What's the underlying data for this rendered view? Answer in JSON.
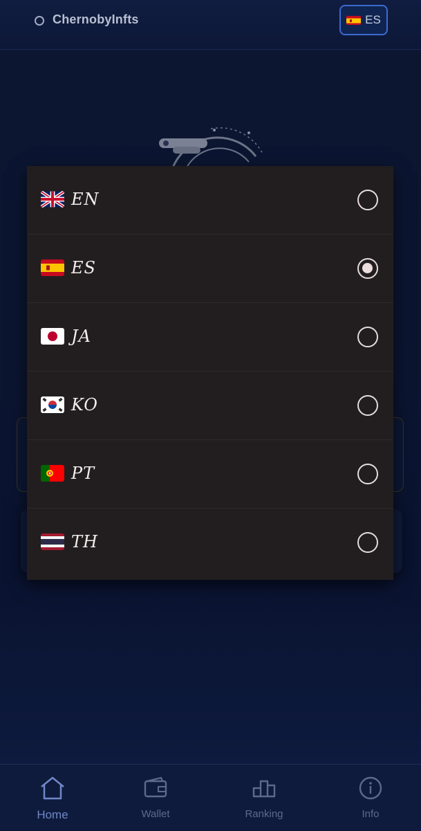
{
  "header": {
    "title": "ChernobyInfts",
    "language_button": {
      "flag": "spain-flag",
      "label": "ES"
    }
  },
  "language_modal": {
    "options": [
      {
        "code": "EN",
        "flag": "uk-flag",
        "selected": false
      },
      {
        "code": "ES",
        "flag": "spain-flag",
        "selected": true
      },
      {
        "code": "JA",
        "flag": "japan-flag",
        "selected": false
      },
      {
        "code": "KO",
        "flag": "korea-flag",
        "selected": false
      },
      {
        "code": "PT",
        "flag": "portugal-flag",
        "selected": false
      },
      {
        "code": "TH",
        "flag": "thailand-flag",
        "selected": false
      }
    ]
  },
  "bottom_nav": {
    "items": [
      {
        "label": "Home",
        "icon": "home-icon",
        "active": true
      },
      {
        "label": "Wallet",
        "icon": "wallet-icon",
        "active": false
      },
      {
        "label": "Ranking",
        "icon": "ranking-icon",
        "active": false
      },
      {
        "label": "Info",
        "icon": "info-icon",
        "active": false
      }
    ]
  },
  "colors": {
    "background": "#0b1530",
    "modal": "#221e1f",
    "accent": "#3d6ad0",
    "active_nav": "#6f88c8",
    "inactive_nav": "#5e6a89"
  }
}
